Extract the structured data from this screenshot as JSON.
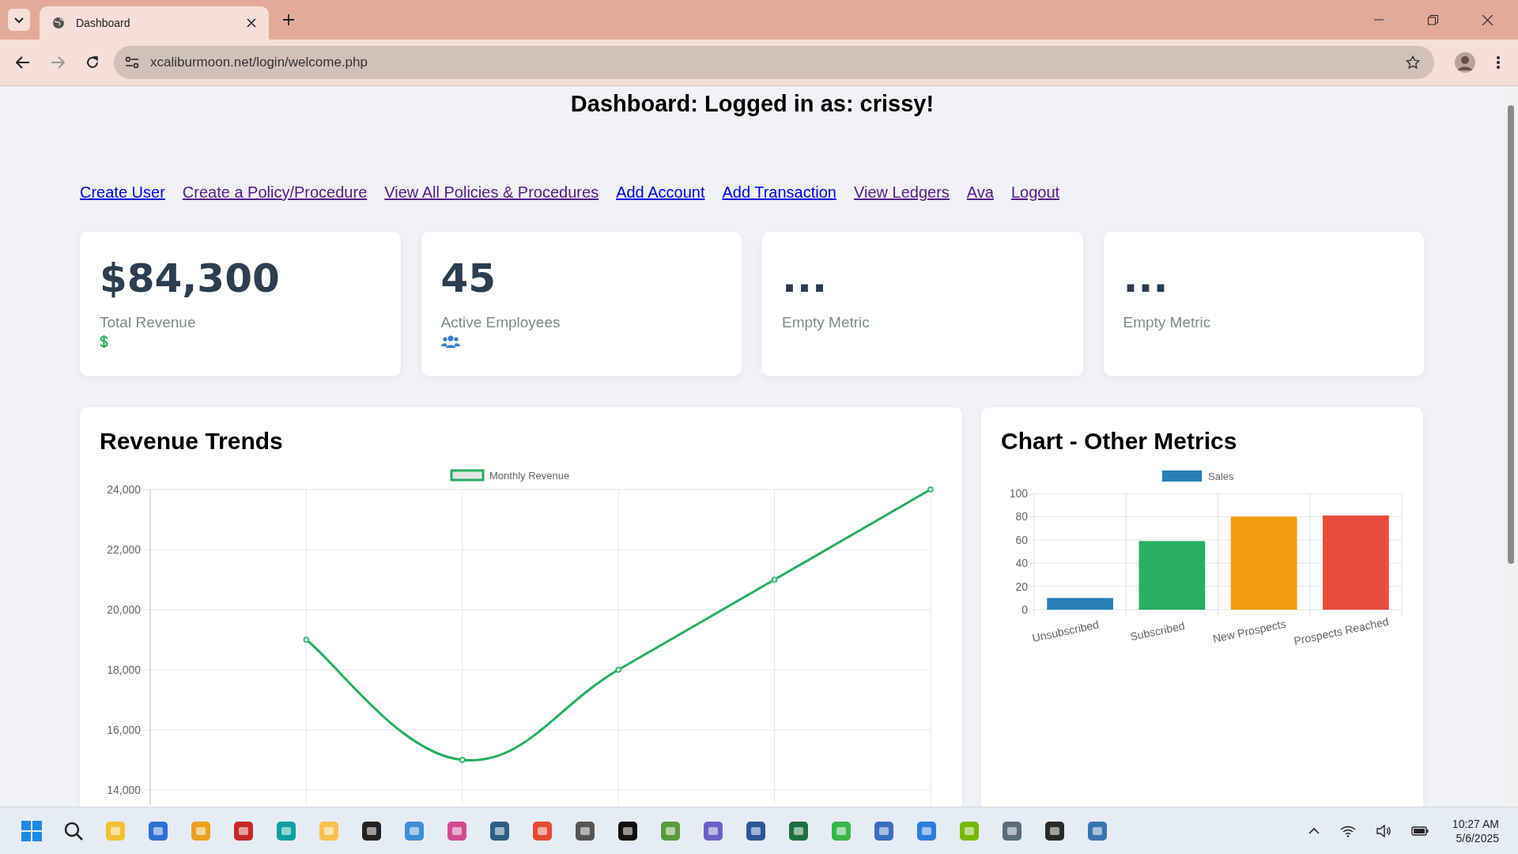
{
  "browser": {
    "tab_title": "Dashboard",
    "url": "xcaliburmoon.net/login/welcome.php"
  },
  "page_title": "Dashboard: Logged in as: crissy!",
  "nav_links": [
    {
      "label": "Create User",
      "visited": false
    },
    {
      "label": "Create a Policy/Procedure",
      "visited": true
    },
    {
      "label": "View All Policies & Procedures",
      "visited": true
    },
    {
      "label": "Add Account",
      "visited": false
    },
    {
      "label": "Add Transaction",
      "visited": false
    },
    {
      "label": "View Ledgers",
      "visited": true
    },
    {
      "label": "Ava",
      "visited": true
    },
    {
      "label": "Logout",
      "visited": true
    }
  ],
  "stat_cards": [
    {
      "value": "$84,300",
      "label": "Total Revenue",
      "kind": "revenue"
    },
    {
      "value": "45",
      "label": "Active Employees",
      "kind": "employees"
    },
    {
      "value": "...",
      "label": "Empty Metric",
      "kind": "empty"
    },
    {
      "value": "...",
      "label": "Empty Metric",
      "kind": "empty"
    }
  ],
  "revenue_panel": {
    "title": "Revenue Trends",
    "chart_data": {
      "type": "line",
      "grid": true,
      "ylim": [
        13500,
        24000
      ],
      "yticks": [
        {
          "value": 14000,
          "label": "14,000"
        },
        {
          "value": 16000,
          "label": "16,000"
        },
        {
          "value": 18000,
          "label": "18,000"
        },
        {
          "value": 20000,
          "label": "20,000"
        },
        {
          "value": 22000,
          "label": "22,000"
        },
        {
          "value": 24000,
          "label": "24,000"
        }
      ],
      "series": [
        {
          "name": "Monthly Revenue",
          "color": "#27ae60",
          "marker": true,
          "values": [
            null,
            19000,
            15000,
            18000,
            21000,
            24000
          ]
        }
      ]
    }
  },
  "metrics_panel": {
    "title": "Chart - Other Metrics",
    "chart_data": {
      "type": "bar",
      "grid": true,
      "stacked": true,
      "categories": [
        "Unsubscribed",
        "Subscribed",
        "New Prospects",
        "Prospects Reached"
      ],
      "ylim": [
        0,
        100
      ],
      "yticks": [
        {
          "value": 0,
          "label": "0"
        },
        {
          "value": 20,
          "label": "20"
        },
        {
          "value": 40,
          "label": "40"
        },
        {
          "value": 60,
          "label": "60"
        },
        {
          "value": 80,
          "label": "80"
        },
        {
          "value": 100,
          "label": "100"
        }
      ],
      "series": [
        {
          "name": "Sales",
          "color": "#2980b9",
          "values": [
            10,
            null,
            null,
            null
          ]
        },
        {
          "color": "#27ae60",
          "values": [
            null,
            59,
            null,
            null
          ]
        },
        {
          "color": "#f39c12",
          "values": [
            null,
            null,
            80,
            null
          ]
        },
        {
          "color": "#e74c3c",
          "values": [
            null,
            null,
            null,
            81
          ]
        }
      ]
    }
  },
  "taskbar": {
    "time": "10:27 AM",
    "date": "5/6/2025"
  }
}
